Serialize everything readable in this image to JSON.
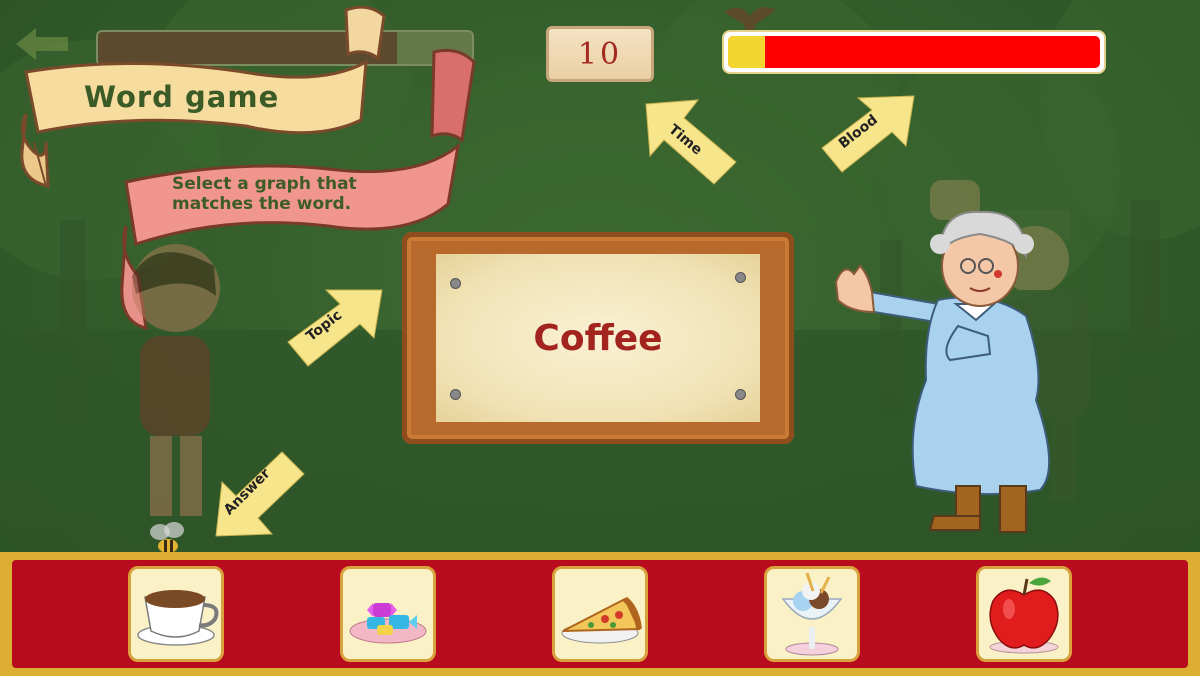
{
  "game": {
    "title": "Word game",
    "instruction": "Select a graph that matches the word.",
    "timer": "10",
    "progress_fraction": 0.8,
    "blood_fraction": 0.1,
    "target_word": "Coffee"
  },
  "hints": {
    "time": "Time",
    "blood": "Blood",
    "topic": "Topic",
    "answer": "Answer"
  },
  "options": [
    {
      "item": "coffee-cup"
    },
    {
      "item": "candy"
    },
    {
      "item": "pizza-slice"
    },
    {
      "item": "ice-cream-sundae"
    },
    {
      "item": "apple"
    }
  ],
  "colors": {
    "blood": "#ff0000",
    "blood_remaining": "#f4d631",
    "word": "#a3231e",
    "tray": "#b80b1d",
    "tray_border": "#dcae31"
  }
}
